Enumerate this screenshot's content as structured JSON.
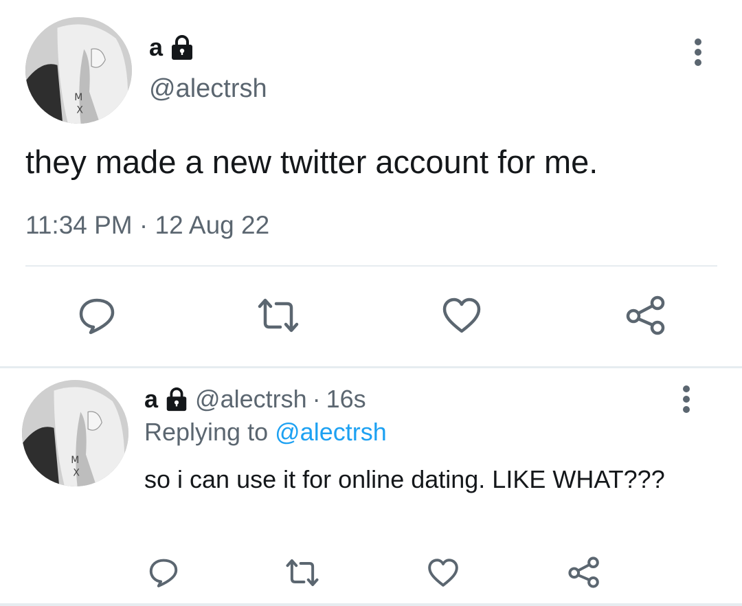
{
  "main_tweet": {
    "display_name": "a",
    "handle": "@alectrsh",
    "text": "they made a new twitter account for me.",
    "timestamp": "11:34 PM · 12 Aug 22",
    "lock_icon": "lock-icon",
    "actions": [
      "reply-icon",
      "retweet-icon",
      "like-icon",
      "share-icon"
    ]
  },
  "reply_tweet": {
    "display_name": "a",
    "handle": "@alectrsh",
    "separator": "·",
    "age": "16s",
    "replying_to_label": "Replying to",
    "replying_to_handle": "@alectrsh",
    "text": "so i can use it for online dating. LIKE WHAT???",
    "lock_icon": "lock-icon",
    "actions": [
      "reply-icon",
      "retweet-icon",
      "like-icon",
      "share-icon"
    ]
  },
  "colors": {
    "text": "#14171a",
    "secondary": "#5b6670",
    "link": "#1da1f2",
    "divider": "#e6ecf0",
    "icon": "#5b6670"
  }
}
